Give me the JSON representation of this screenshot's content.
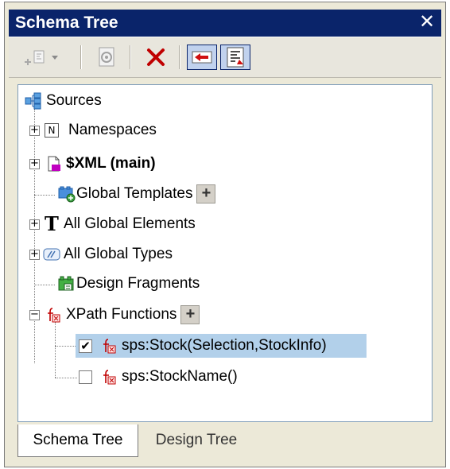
{
  "window": {
    "title": "Schema Tree",
    "close_label": "✕"
  },
  "toolbar": {
    "buttons": [
      {
        "name": "add-element",
        "icon": "add-element-icon"
      },
      {
        "name": "properties",
        "icon": "properties-icon"
      },
      {
        "name": "delete",
        "icon": "delete-icon"
      },
      {
        "name": "go-back",
        "icon": "arrow-left-icon"
      },
      {
        "name": "sort",
        "icon": "sort-icon"
      }
    ],
    "delete_glyph": "✕"
  },
  "tree": {
    "root": {
      "label": "Sources"
    },
    "items": [
      {
        "label": "Namespaces",
        "expander": "+"
      },
      {
        "label": "$XML (main)",
        "expander": "+"
      },
      {
        "label": "Global Templates"
      },
      {
        "label": "All Global Elements",
        "expander": "+"
      },
      {
        "label": "All Global Types",
        "expander": "+"
      },
      {
        "label": "Design Fragments"
      },
      {
        "label": "XPath Functions",
        "expander": "−"
      }
    ],
    "functions": [
      {
        "label": "sps:Stock(Selection,StockInfo)",
        "checked": true
      },
      {
        "label": "sps:StockName()",
        "checked": false
      }
    ],
    "add_glyph": "+",
    "check_glyph": "✔",
    "namespaces_glyph": "N",
    "elements_glyph": "T"
  },
  "tabs": [
    {
      "label": "Schema Tree",
      "active": true
    },
    {
      "label": "Design Tree",
      "active": false
    }
  ],
  "colors": {
    "titlebar": "#0a246a",
    "selection": "#b2d0ea",
    "fx_red": "#c00000"
  }
}
